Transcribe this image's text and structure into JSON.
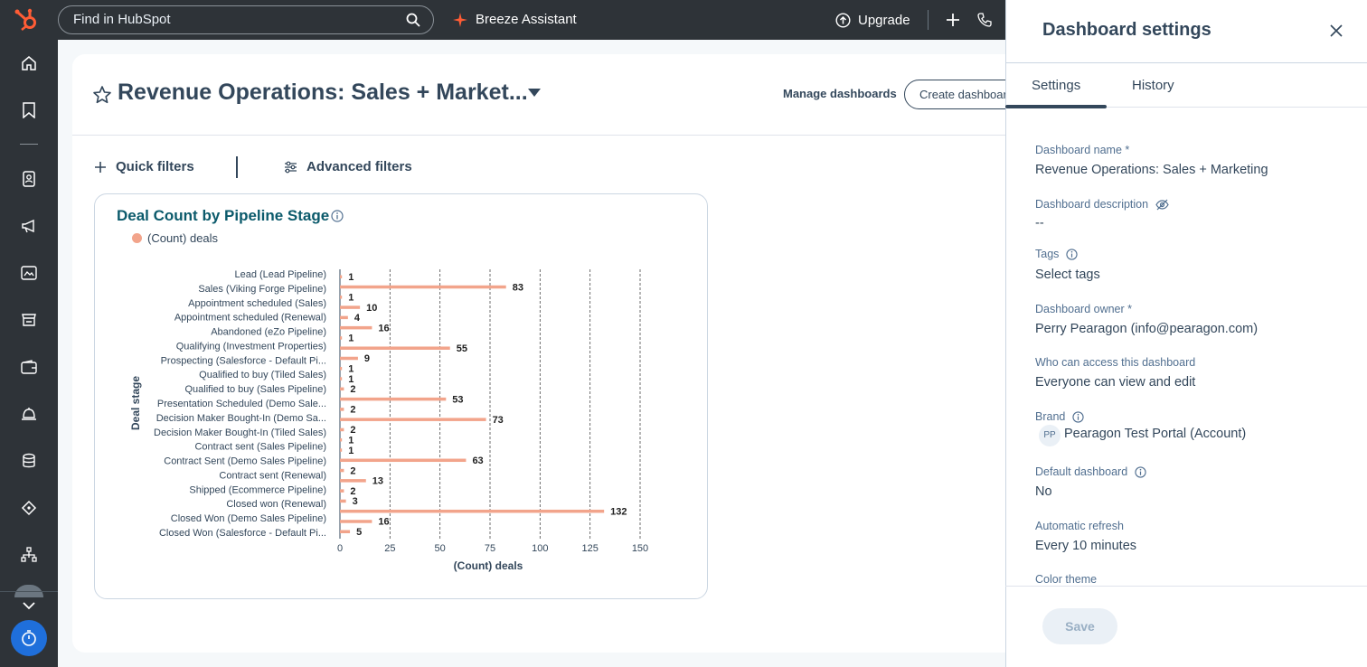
{
  "topbar": {
    "search_placeholder": "Find in HubSpot",
    "breeze_label": "Breeze Assistant",
    "upgrade_label": "Upgrade"
  },
  "dashboard": {
    "title": "Revenue Operations: Sales + Market...",
    "manage_label": "Manage dashboards",
    "create_label": "Create dashboard",
    "quick_filters": "Quick filters",
    "advanced_filters": "Advanced filters"
  },
  "report": {
    "title": "Deal Count by Pipeline Stage",
    "legend": "(Count) deals"
  },
  "chart_data": {
    "type": "bar",
    "orientation": "horizontal",
    "title": "Deal Count by Pipeline Stage",
    "xlabel": "(Count) deals",
    "ylabel": "Deal stage",
    "xlim": [
      0,
      150
    ],
    "xticks": [
      0,
      25,
      50,
      75,
      100,
      125,
      150
    ],
    "grid": true,
    "legend_position": "top-left",
    "series_color": "#f2a48b",
    "categories": [
      "Lead (Lead Pipeline)",
      "Sales (Viking Forge Pipeline)",
      "Appointment scheduled (Sales)",
      "Appointment scheduled (Renewal)",
      "Abandoned (eZo Pipeline)",
      "Qualifying (Investment Properties)",
      "Prospecting (Salesforce - Default Pi...",
      "Qualified to buy (Tiled Sales)",
      "Qualified to buy (Sales Pipeline)",
      "Presentation Scheduled (Demo Sale...",
      "Decision Maker Bought-In (Demo Sa...",
      "Decision Maker Bought-In (Tiled Sales)",
      "Contract sent (Sales Pipeline)",
      "Contract Sent (Demo Sales Pipeline)",
      "Contract sent (Renewal)",
      "Shipped (Ecommerce Pipeline)",
      "Closed won (Renewal)",
      "Closed Won (Demo Sales Pipeline)",
      "Closed Won (Salesforce - Default Pi..."
    ],
    "series": [
      {
        "name": "(Count) deals",
        "values": [
          1,
          83,
          1,
          10,
          4,
          16,
          1,
          55,
          9,
          1,
          1,
          2,
          53,
          2,
          73,
          2,
          1,
          1,
          63,
          2,
          13,
          2,
          3,
          132,
          16,
          5
        ]
      }
    ]
  },
  "panel": {
    "title": "Dashboard settings",
    "tabs": [
      "Settings",
      "History"
    ],
    "fields": {
      "name_label": "Dashboard name *",
      "name_value": "Revenue Operations: Sales + Marketing",
      "desc_label": "Dashboard description",
      "desc_value": "--",
      "tags_label": "Tags",
      "tags_value": "Select tags",
      "owner_label": "Dashboard owner *",
      "owner_value": "Perry Pearagon (info@pearagon.com)",
      "access_label": "Who can access this dashboard",
      "access_value": "Everyone can view and edit",
      "brand_label": "Brand",
      "brand_initials": "PP",
      "brand_value": "Pearagon Test Portal (Account)",
      "default_label": "Default dashboard",
      "default_value": "No",
      "refresh_label": "Automatic refresh",
      "refresh_value": "Every 10 minutes",
      "theme_label": "Color theme"
    },
    "save_label": "Save"
  },
  "colors": {
    "brand": "#ff5c35",
    "nav_bg": "#2e3338",
    "bar": "#f2a48b",
    "report_title": "#0b5a6b",
    "timer": "#1f6fdb"
  }
}
